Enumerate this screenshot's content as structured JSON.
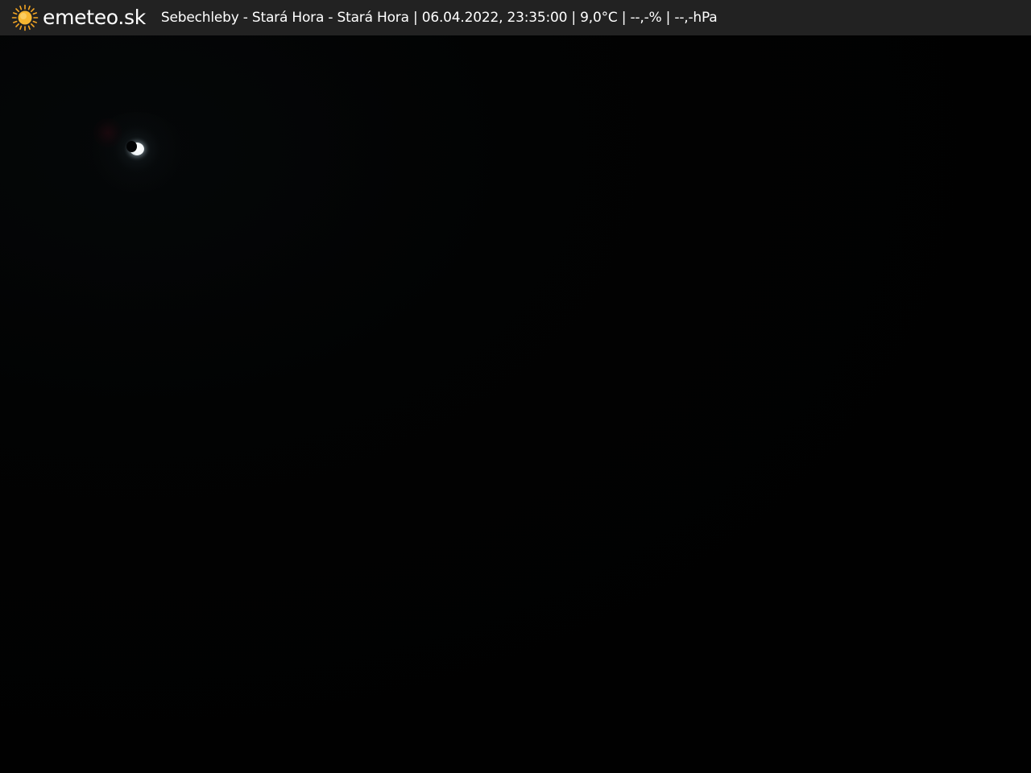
{
  "header": {
    "brand": "emeteo.sk",
    "caption": "Sebechleby - Stará Hora - Stará Hora | 06.04.2022, 23:35:00 | 9,0°C | --,-% | --,-hPa",
    "logo_icon": "sun-icon"
  },
  "colors": {
    "topbar_background": "#222222",
    "sun_icon": "#f5a623",
    "text": "#ffffff",
    "sky": "#010101"
  }
}
